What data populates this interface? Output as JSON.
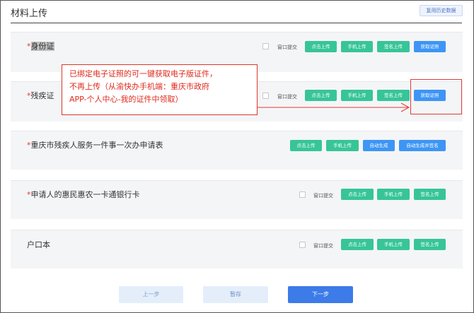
{
  "page": {
    "title": "材料上传",
    "history_button": "复用历史数据"
  },
  "sections": [
    {
      "label": "身份证",
      "required": true,
      "window_submit": "窗口提交",
      "buttons": [
        "点击上传",
        "手机上传",
        "签名上传",
        "获取证照"
      ]
    },
    {
      "label": "残疾证",
      "required": true,
      "window_submit": "窗口提交",
      "buttons": [
        "点击上传",
        "手机上传",
        "签名上传",
        "获取证照"
      ]
    },
    {
      "label": "重庆市残疾人服务一件事一次办申请表",
      "required": true,
      "buttons": [
        "点击上传",
        "手机上传",
        "自动生成",
        "自动生成并签名"
      ]
    },
    {
      "label": "申请人的惠民惠农一卡通银行卡",
      "required": true,
      "window_submit": "窗口提交",
      "buttons": [
        "点击上传",
        "手机上传",
        "签名上传"
      ]
    },
    {
      "label": "户口本",
      "required": false,
      "window_submit": "窗口提交",
      "buttons": [
        "点击上传",
        "手机上传",
        "签名上传"
      ]
    }
  ],
  "annotation": {
    "lines": [
      "已绑定电子证照的可一键获取电子版证件，",
      "不再上传（从渝快办手机端：重庆市政府",
      "APP-个人中心-我的证件中领取）"
    ],
    "color": "#e0291c"
  },
  "footer": {
    "prev": "上一步",
    "save": "暂存",
    "next": "下一步"
  },
  "colors": {
    "green_button": "#37c598",
    "blue_button": "#3d95f5",
    "primary": "#3c7be8",
    "required_mark": "#e53935"
  }
}
